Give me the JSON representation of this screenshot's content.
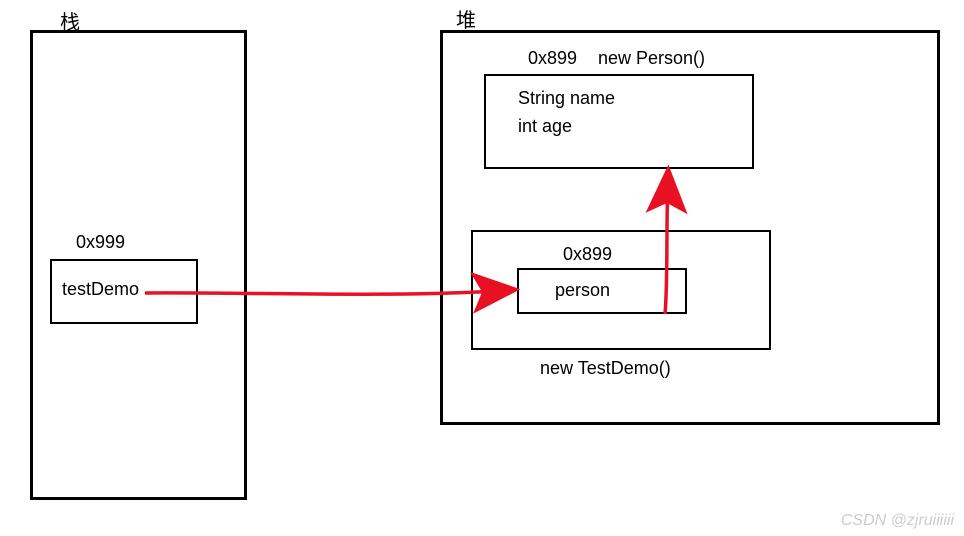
{
  "stack": {
    "title": "栈",
    "address": "0x999",
    "variable": "testDemo"
  },
  "heap": {
    "title": "堆",
    "person_object": {
      "address": "0x899",
      "constructor": "new Person()",
      "field1": "String name",
      "field2": "int age"
    },
    "testdemo_object": {
      "constructor": "new TestDemo()",
      "inner_address": "0x899",
      "inner_variable": "person"
    }
  },
  "watermark": "CSDN @zjruiiiiii"
}
